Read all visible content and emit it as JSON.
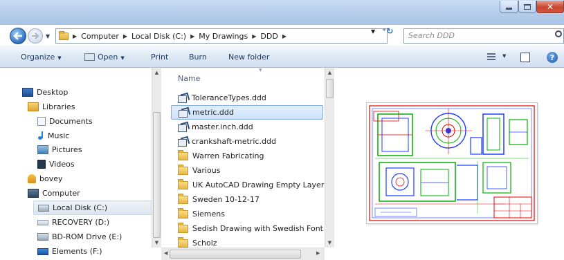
{
  "window": {
    "controls": {
      "minimize": "–",
      "maximize": "□",
      "close": "✕"
    }
  },
  "address": {
    "crumbs": [
      "Computer",
      "Local Disk (C:)",
      "My Drawings",
      "DDD"
    ],
    "search_placeholder": "Search DDD"
  },
  "toolbar": {
    "organize": "Organize",
    "open": "Open",
    "print": "Print",
    "burn": "Burn",
    "new_folder": "New folder",
    "help": "?"
  },
  "navpane": {
    "items": [
      {
        "label": "Desktop",
        "icon": "desktop-icon"
      },
      {
        "label": "Libraries",
        "icon": "libraries-icon"
      },
      {
        "label": "Documents",
        "icon": "documents-icon"
      },
      {
        "label": "Music",
        "icon": "music-icon"
      },
      {
        "label": "Pictures",
        "icon": "pictures-icon"
      },
      {
        "label": "Videos",
        "icon": "videos-icon"
      },
      {
        "label": "bovey",
        "icon": "user-folder-icon"
      },
      {
        "label": "Computer",
        "icon": "computer-icon"
      },
      {
        "label": "Local Disk (C:)",
        "icon": "local-disk-icon",
        "selected": true
      },
      {
        "label": "RECOVERY (D:)",
        "icon": "drive-icon"
      },
      {
        "label": "BD-ROM Drive (E:)",
        "icon": "bd-rom-icon"
      },
      {
        "label": "Elements (F:)",
        "icon": "external-drive-icon"
      }
    ]
  },
  "filelist": {
    "column_name": "Name",
    "items": [
      {
        "name": "ToleranceTypes.ddd",
        "type": "file"
      },
      {
        "name": "metric.ddd",
        "type": "file",
        "selected": true
      },
      {
        "name": "master.inch.ddd",
        "type": "file"
      },
      {
        "name": "crankshaft-metric.ddd",
        "type": "file"
      },
      {
        "name": "Warren Fabricating",
        "type": "folder"
      },
      {
        "name": "Various",
        "type": "folder"
      },
      {
        "name": "UK AutoCAD Drawing Empty Layers",
        "type": "folder"
      },
      {
        "name": "Sweden 10-12-17",
        "type": "folder"
      },
      {
        "name": "Siemens",
        "type": "folder"
      },
      {
        "name": "Sedish Drawing with Swedish Font",
        "type": "folder"
      },
      {
        "name": "Scholz",
        "type": "folder"
      }
    ]
  },
  "preview": {
    "icon": "cad-drawing-preview"
  },
  "colors": {
    "titlebar": "#b9cfec",
    "selection": "#cfe2fa",
    "cad_green": "#00b000",
    "cad_blue": "#1c3cff",
    "cad_red": "#e00000"
  }
}
